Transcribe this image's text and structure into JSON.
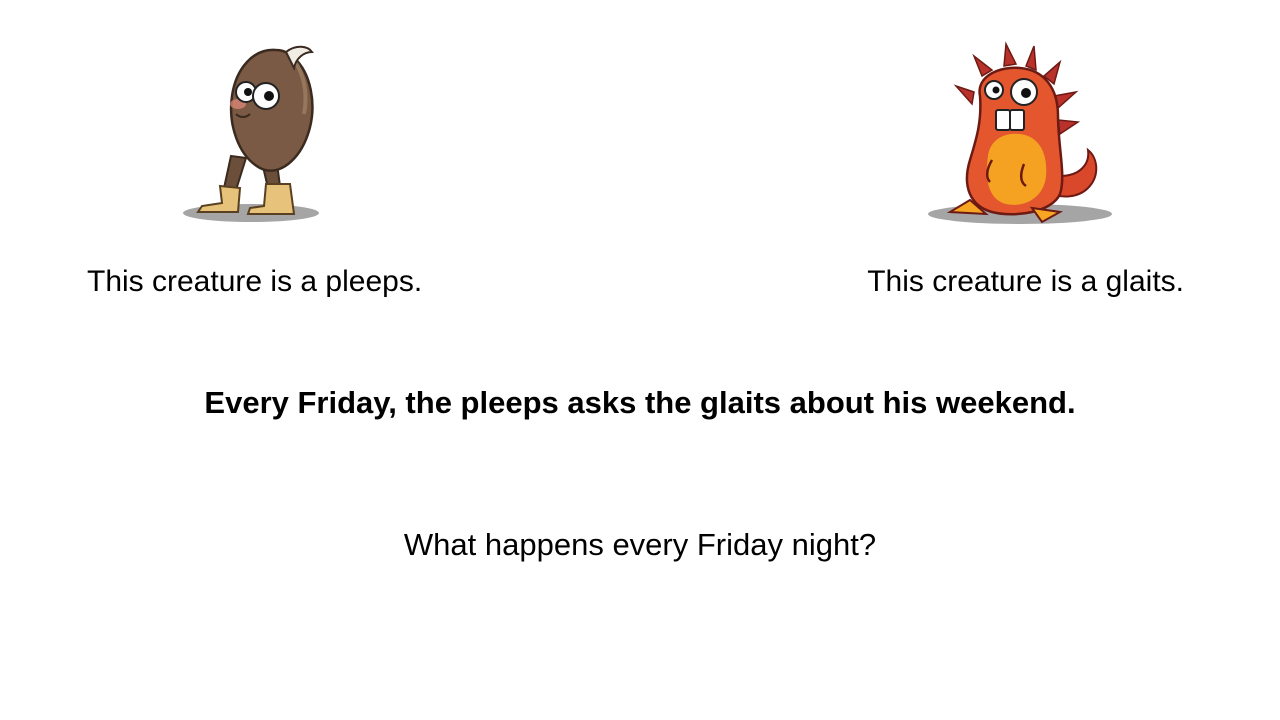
{
  "creatures": {
    "pleeps": {
      "icon": "pleeps-creature-icon",
      "caption": "This creature is a pleeps.",
      "colors": {
        "body": "#7a5a44",
        "boots": "#e6c27a",
        "shadow": "#8e8e8e"
      }
    },
    "glaits": {
      "icon": "glaits-creature-icon",
      "caption": "This creature is a glaits.",
      "colors": {
        "body": "#e4572e",
        "belly": "#f6a623",
        "spikes": "#b8312a",
        "shadow": "#8e8e8e"
      }
    }
  },
  "statement": "Every Friday, the pleeps asks the glaits about his weekend.",
  "question": "What happens every Friday night?"
}
